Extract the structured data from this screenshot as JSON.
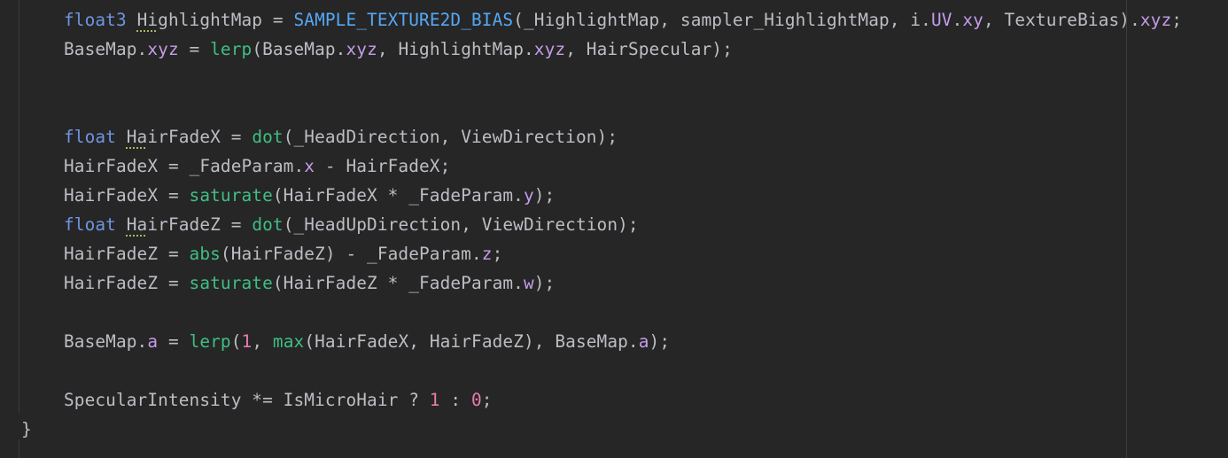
{
  "editor": {
    "lines": [
      {
        "indent": true,
        "tokens": [
          {
            "t": "float3 ",
            "c": "kw"
          },
          {
            "t": "HighlightMap",
            "c": "txt",
            "squig": "Hi"
          },
          {
            "t": " = ",
            "c": "txt"
          },
          {
            "t": "SAMPLE_TEXTURE2D_BIAS",
            "c": "fn"
          },
          {
            "t": "(_HighlightMap, sampler_HighlightMap, i.",
            "c": "txt"
          },
          {
            "t": "UV",
            "c": "fld"
          },
          {
            "t": ".",
            "c": "txt"
          },
          {
            "t": "xy",
            "c": "fld"
          },
          {
            "t": ", TextureBias).",
            "c": "txt"
          },
          {
            "t": "xyz",
            "c": "fld"
          },
          {
            "t": ";",
            "c": "txt"
          }
        ]
      },
      {
        "indent": true,
        "tokens": [
          {
            "t": "BaseMap.",
            "c": "txt"
          },
          {
            "t": "xyz",
            "c": "fld"
          },
          {
            "t": " = ",
            "c": "txt"
          },
          {
            "t": "lerp",
            "c": "call"
          },
          {
            "t": "(BaseMap.",
            "c": "txt"
          },
          {
            "t": "xyz",
            "c": "fld"
          },
          {
            "t": ", HighlightMap.",
            "c": "txt"
          },
          {
            "t": "xyz",
            "c": "fld"
          },
          {
            "t": ", HairSpecular);",
            "c": "txt"
          }
        ]
      },
      {
        "indent": true,
        "tokens": []
      },
      {
        "indent": true,
        "tokens": []
      },
      {
        "indent": true,
        "tokens": [
          {
            "t": "float ",
            "c": "kw"
          },
          {
            "t": "HairFadeX",
            "c": "txt",
            "squig": "Ha"
          },
          {
            "t": " = ",
            "c": "txt"
          },
          {
            "t": "dot",
            "c": "call"
          },
          {
            "t": "(_HeadDirection, ViewDirection);",
            "c": "txt"
          }
        ]
      },
      {
        "indent": true,
        "tokens": [
          {
            "t": "HairFadeX = _FadeParam.",
            "c": "txt"
          },
          {
            "t": "x",
            "c": "fld"
          },
          {
            "t": " - HairFadeX;",
            "c": "txt"
          }
        ]
      },
      {
        "indent": true,
        "tokens": [
          {
            "t": "HairFadeX = ",
            "c": "txt"
          },
          {
            "t": "saturate",
            "c": "call"
          },
          {
            "t": "(HairFadeX * _FadeParam.",
            "c": "txt"
          },
          {
            "t": "y",
            "c": "fld"
          },
          {
            "t": ");",
            "c": "txt"
          }
        ]
      },
      {
        "indent": true,
        "tokens": [
          {
            "t": "float ",
            "c": "kw"
          },
          {
            "t": "HairFadeZ",
            "c": "txt",
            "squig": "Ha"
          },
          {
            "t": " = ",
            "c": "txt"
          },
          {
            "t": "dot",
            "c": "call"
          },
          {
            "t": "(_HeadUpDirection, ViewDirection);",
            "c": "txt"
          }
        ]
      },
      {
        "indent": true,
        "tokens": [
          {
            "t": "HairFadeZ = ",
            "c": "txt"
          },
          {
            "t": "abs",
            "c": "call"
          },
          {
            "t": "(HairFadeZ) - _FadeParam.",
            "c": "txt"
          },
          {
            "t": "z",
            "c": "fld"
          },
          {
            "t": ";",
            "c": "txt"
          }
        ]
      },
      {
        "indent": true,
        "tokens": [
          {
            "t": "HairFadeZ = ",
            "c": "txt"
          },
          {
            "t": "saturate",
            "c": "call"
          },
          {
            "t": "(HairFadeZ * _FadeParam.",
            "c": "txt"
          },
          {
            "t": "w",
            "c": "fld"
          },
          {
            "t": ");",
            "c": "txt"
          }
        ]
      },
      {
        "indent": true,
        "tokens": []
      },
      {
        "indent": true,
        "tokens": [
          {
            "t": "BaseMap.",
            "c": "txt"
          },
          {
            "t": "a",
            "c": "fld"
          },
          {
            "t": " = ",
            "c": "txt"
          },
          {
            "t": "lerp",
            "c": "call"
          },
          {
            "t": "(",
            "c": "txt"
          },
          {
            "t": "1",
            "c": "num"
          },
          {
            "t": ", ",
            "c": "txt"
          },
          {
            "t": "max",
            "c": "call"
          },
          {
            "t": "(HairFadeX, HairFadeZ), BaseMap.",
            "c": "txt"
          },
          {
            "t": "a",
            "c": "fld"
          },
          {
            "t": ");",
            "c": "txt"
          }
        ]
      },
      {
        "indent": true,
        "tokens": []
      },
      {
        "indent": true,
        "tokens": [
          {
            "t": "SpecularIntensity *= IsMicroHair ? ",
            "c": "txt"
          },
          {
            "t": "1",
            "c": "num"
          },
          {
            "t": " : ",
            "c": "txt"
          },
          {
            "t": "0",
            "c": "num"
          },
          {
            "t": ";",
            "c": "txt"
          }
        ]
      },
      {
        "indent": false,
        "tokens": [
          {
            "t": "}",
            "c": "txt"
          }
        ]
      }
    ],
    "colors": {
      "background": "#262626",
      "keyword": "#6f95e0",
      "macro": "#56a8f5",
      "function_call": "#3fbf83",
      "number": "#e87cac",
      "field": "#c59ceb",
      "text": "#bcbec4"
    }
  }
}
